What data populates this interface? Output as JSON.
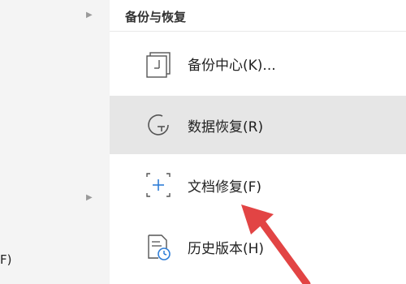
{
  "left_panel": {
    "partial_item_label": "F)"
  },
  "backup_menu": {
    "header": "备份与恢复",
    "items": [
      {
        "label": "备份中心(K)...",
        "icon": "backup-center-icon"
      },
      {
        "label": "数据恢复(R)",
        "icon": "data-recovery-icon"
      },
      {
        "label": "文档修复(F)",
        "icon": "document-repair-icon"
      },
      {
        "label": "历史版本(H)",
        "icon": "history-version-icon"
      }
    ]
  },
  "annotation": {
    "arrow_color": "#e24444"
  }
}
